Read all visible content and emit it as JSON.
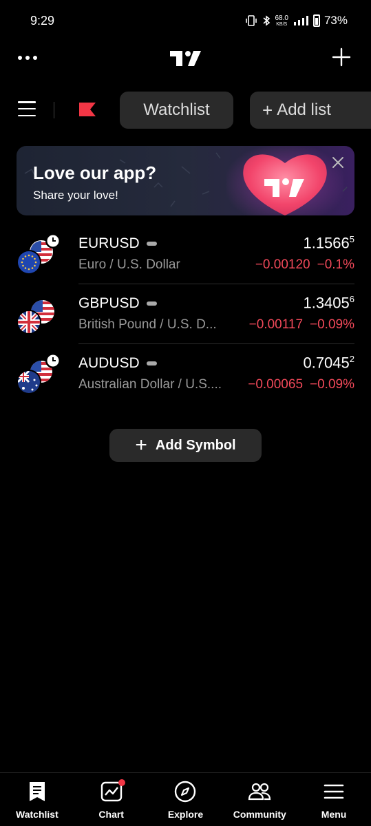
{
  "status_bar": {
    "time": "9:29",
    "net_speed_value": "68.0",
    "net_speed_unit": "KB/S",
    "battery": "73%"
  },
  "toolbar": {
    "watchlist_label": "Watchlist",
    "add_list_label": "Add list"
  },
  "banner": {
    "title": "Love our app?",
    "subtitle": "Share your love!"
  },
  "symbols": [
    {
      "ticker": "EURUSD",
      "description": "Euro / U.S. Dollar",
      "price": "1.1566",
      "price_sup": "5",
      "change": "−0.00120",
      "change_pct": "−0.1%"
    },
    {
      "ticker": "GBPUSD",
      "description": "British Pound / U.S. D...",
      "price": "1.3405",
      "price_sup": "6",
      "change": "−0.00117",
      "change_pct": "−0.09%"
    },
    {
      "ticker": "AUDUSD",
      "description": "Australian Dollar / U.S....",
      "price": "0.7045",
      "price_sup": "2",
      "change": "−0.00065",
      "change_pct": "−0.09%"
    }
  ],
  "add_symbol_label": "Add Symbol",
  "bottom_nav": [
    {
      "label": "Watchlist",
      "icon": "watchlist-icon"
    },
    {
      "label": "Chart",
      "icon": "chart-icon"
    },
    {
      "label": "Explore",
      "icon": "compass-icon"
    },
    {
      "label": "Community",
      "icon": "community-icon"
    },
    {
      "label": "Menu",
      "icon": "menu-icon"
    }
  ],
  "colors": {
    "background": "#000000",
    "negative": "#f2495a",
    "pill": "#2a2a2a",
    "accent_red": "#f23645"
  }
}
